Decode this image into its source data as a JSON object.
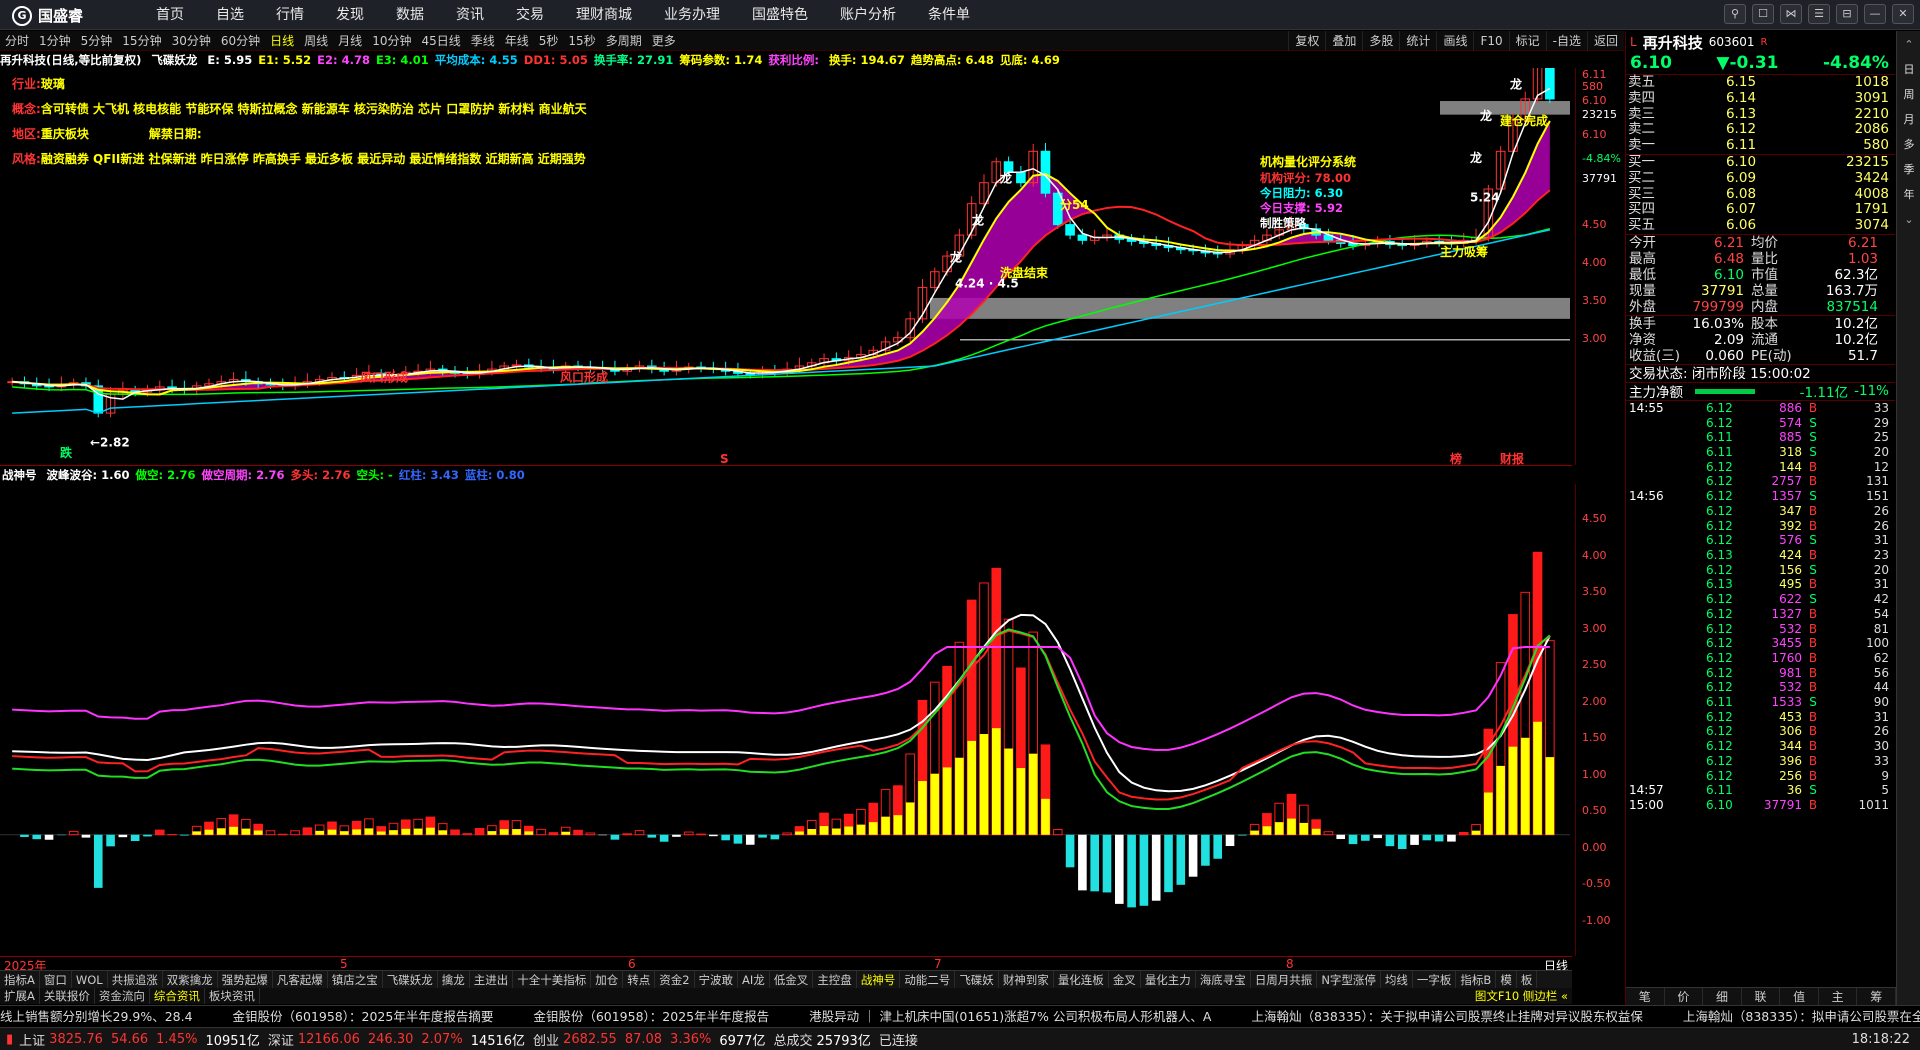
{
  "app": {
    "name": "国盛睿"
  },
  "menu": [
    "首页",
    "自选",
    "行情",
    "发现",
    "数据",
    "资讯",
    "交易",
    "理财商城",
    "业务办理",
    "国盛特色",
    "账户分析",
    "条件单"
  ],
  "window_controls": [
    "⚲",
    "☐",
    "⋈",
    "☰",
    "⊟",
    "—",
    "✕"
  ],
  "periods": [
    "分时",
    "1分钟",
    "5分钟",
    "15分钟",
    "30分钟",
    "60分钟",
    "日线",
    "周线",
    "月线",
    "10分钟",
    "45日线",
    "季线",
    "年线",
    "5秒",
    "15秒",
    "多周期",
    "更多"
  ],
  "active_period": "日线",
  "chart_tools": [
    "复权",
    "叠加",
    "多股",
    "统计",
    "画线",
    "F10",
    "标记",
    "-自选",
    "返回"
  ],
  "main_indicator": {
    "prefix": "再升科技(日线,等比前复权)",
    "name": "飞碟妖龙",
    "items": [
      {
        "t": "E: 5.95",
        "c": "#ffffff"
      },
      {
        "t": "E1: 5.52",
        "c": "#ffff00"
      },
      {
        "t": "E2: 4.78",
        "c": "#ff44ff"
      },
      {
        "t": "E3: 4.01",
        "c": "#00ff00"
      },
      {
        "t": "平均成本: 4.55",
        "c": "#00ccff"
      },
      {
        "t": "DD1: 5.05",
        "c": "#ff3333"
      },
      {
        "t": "换手率: 27.91",
        "c": "#00ff88"
      },
      {
        "t": "筹码参数: 1.74",
        "c": "#ffff00"
      },
      {
        "t": "获利比例: ",
        "c": "#ff44ff"
      },
      {
        "t": "换手: 194.67",
        "c": "#ffff00"
      },
      {
        "t": "趋势高点: 6.48",
        "c": "#ffff00"
      },
      {
        "t": "见底: 4.69",
        "c": "#ffff00"
      }
    ]
  },
  "stock_info": {
    "industry_label": "行业:",
    "industry": "玻璃",
    "concept_label": "概念:",
    "concepts": "含可转债 大飞机 核电核能 节能环保 特斯拉概念 新能源车 核污染防治 芯片 口罩防护 新材料 商业航天",
    "region_label": "地区:",
    "region": "重庆板块",
    "unlock_label": "解禁日期:",
    "style_label": "风格:",
    "styles": "融资融券 QFII新进 社保新进 昨日涨停 昨高换手 最近多板 最近异动 最近情绪指数 近期新高 近期强势"
  },
  "quant_box": {
    "title": "机构量化评分系统",
    "items": [
      {
        "t": "机构评分: 78.00",
        "c": "#ff3333"
      },
      {
        "t": "今日阻力: 6.30",
        "c": "#00ffff"
      },
      {
        "t": "今日支撑: 5.92",
        "c": "#ff44ff"
      },
      {
        "t": "制胜策略",
        "c": "#ffffff"
      }
    ]
  },
  "annotations": {
    "low_price": "←2.82",
    "up_low": "跌",
    "fengkou1": "风口形成",
    "fengkou2": "风口形成",
    "dragon": "龙",
    "fen": "分54",
    "xuanpan": "洗盘结束",
    "price_424": "4.24 · 4.5",
    "price_524": "5.24",
    "suo": "建仓完成",
    "zhuli": "主力吸筹",
    "high_label": "6.48",
    "bottom_mark1": "榜",
    "bottom_mark2": "财报",
    "s_mark": "S"
  },
  "main_axis": [
    "6.11",
    "580",
    "6.10",
    "23215",
    "6.10",
    "-4.84%",
    "37791",
    "4.50",
    "4.00",
    "3.50",
    "3.00"
  ],
  "sub_indicator": {
    "name": "战神号",
    "items": [
      {
        "t": "波峰波谷: 1.60",
        "c": "#ffffff"
      },
      {
        "t": "做空: 2.76",
        "c": "#00ff00"
      },
      {
        "t": "做空周期: 2.76",
        "c": "#ff44ff"
      },
      {
        "t": "多头: 2.76",
        "c": "#ff3333"
      },
      {
        "t": "空头: -",
        "c": "#00ff00"
      },
      {
        "t": "红柱: 3.43",
        "c": "#3366ff"
      },
      {
        "t": "蓝柱: 0.80",
        "c": "#3366ff"
      }
    ]
  },
  "sub_axis": [
    "4.50",
    "4.00",
    "3.50",
    "3.00",
    "2.50",
    "2.00",
    "1.50",
    "1.00",
    "0.50",
    "0.00",
    "-0.50",
    "-1.00"
  ],
  "xaxis": {
    "labels": [
      "2025年",
      "5",
      "6",
      "7",
      "8"
    ],
    "period": "日线"
  },
  "tabs1": [
    "指标A",
    "窗口",
    "WOL",
    "共振追涨",
    "双紫擒龙",
    "强势起爆",
    "凡客起爆",
    "镇店之宝",
    "飞碟妖龙",
    "擒龙",
    "主进出",
    "十全十美指标",
    "加仓",
    "转点",
    "资金2",
    "宁波敢",
    "AI龙",
    "低金叉",
    "主控盘",
    "战神号",
    "动能二号",
    "飞碟妖",
    "财神到家",
    "量化连板",
    "金叉",
    "量化主力",
    "海底寻宝",
    "日周月共振",
    "N字型涨停",
    "均线",
    "一字板",
    "指标B",
    "模",
    "板"
  ],
  "tabs1_active": "战神号",
  "tabs2": [
    "扩展A",
    "关联报价",
    "资金流向",
    "综合资讯",
    "板块资讯"
  ],
  "tabs2_active": "综合资讯",
  "tabs2_right": "图文F10 侧边栏 «",
  "right_panel": {
    "L": "L",
    "name": "再升科技",
    "code": "603601",
    "R": "R",
    "price": "6.10",
    "change": "▼-0.31",
    "pct": "-4.84%",
    "asks": [
      {
        "l": "卖五",
        "p": "6.15",
        "v": "1018"
      },
      {
        "l": "卖四",
        "p": "6.14",
        "v": "3091"
      },
      {
        "l": "卖三",
        "p": "6.13",
        "v": "2210"
      },
      {
        "l": "卖二",
        "p": "6.12",
        "v": "2086"
      },
      {
        "l": "卖一",
        "p": "6.11",
        "v": "580"
      }
    ],
    "bids": [
      {
        "l": "买一",
        "p": "6.10",
        "v": "23215"
      },
      {
        "l": "买二",
        "p": "6.09",
        "v": "3424"
      },
      {
        "l": "买三",
        "p": "6.08",
        "v": "4008"
      },
      {
        "l": "买四",
        "p": "6.07",
        "v": "1791"
      },
      {
        "l": "买五",
        "p": "6.06",
        "v": "3074"
      }
    ],
    "stats": [
      [
        "今开",
        "6.21",
        "vr",
        "均价",
        "6.21",
        "vr"
      ],
      [
        "最高",
        "6.48",
        "vr",
        "量比",
        "1.03",
        "vr"
      ],
      [
        "最低",
        "6.10",
        "vg",
        "市值",
        "62.3亿",
        "vw"
      ],
      [
        "现量",
        "37791",
        "vy",
        "总量",
        "163.7万",
        "vw"
      ],
      [
        "外盘",
        "799799",
        "vr",
        "内盘",
        "837514",
        "vg"
      ]
    ],
    "stats2": [
      [
        "换手",
        "16.03%",
        "vw",
        "股本",
        "10.2亿",
        "vw"
      ],
      [
        "净资",
        "2.09",
        "vw",
        "流通",
        "10.2亿",
        "vw"
      ],
      [
        "收益(三)",
        "0.060",
        "vw",
        "PE(动)",
        "51.7",
        "vw"
      ]
    ],
    "trade_state": "交易状态: 闭市阶段 15:00:02",
    "mainflow_label": "主力净额",
    "mainflow_val": "-1.11亿",
    "mainflow_pct": "-11%",
    "ticks": [
      {
        "t": "14:55",
        "p": "6.12",
        "v": "886",
        "vc": "#ff44ff",
        "s": "B",
        "sc": "#ff3333",
        "n": "33"
      },
      {
        "t": "",
        "p": "6.12",
        "v": "574",
        "vc": "#ff44ff",
        "s": "S",
        "sc": "#00ff66",
        "n": "29"
      },
      {
        "t": "",
        "p": "6.11",
        "v": "885",
        "vc": "#ff44ff",
        "s": "S",
        "sc": "#00ff66",
        "n": "25"
      },
      {
        "t": "",
        "p": "6.11",
        "v": "318",
        "vc": "#ffff66",
        "s": "S",
        "sc": "#00ff66",
        "n": "20"
      },
      {
        "t": "",
        "p": "6.12",
        "v": "144",
        "vc": "#ffff66",
        "s": "B",
        "sc": "#ff3333",
        "n": "12"
      },
      {
        "t": "",
        "p": "6.12",
        "v": "2757",
        "vc": "#ff44ff",
        "s": "B",
        "sc": "#ff3333",
        "n": "131"
      },
      {
        "t": "14:56",
        "p": "6.12",
        "v": "1357",
        "vc": "#ff44ff",
        "s": "S",
        "sc": "#00ff66",
        "n": "151"
      },
      {
        "t": "",
        "p": "6.12",
        "v": "347",
        "vc": "#ffff66",
        "s": "B",
        "sc": "#ff3333",
        "n": "26"
      },
      {
        "t": "",
        "p": "6.12",
        "v": "392",
        "vc": "#ffff66",
        "s": "B",
        "sc": "#ff3333",
        "n": "26"
      },
      {
        "t": "",
        "p": "6.12",
        "v": "576",
        "vc": "#ff44ff",
        "s": "S",
        "sc": "#00ff66",
        "n": "31"
      },
      {
        "t": "",
        "p": "6.13",
        "v": "424",
        "vc": "#ffff66",
        "s": "B",
        "sc": "#ff3333",
        "n": "23"
      },
      {
        "t": "",
        "p": "6.12",
        "v": "156",
        "vc": "#ffff66",
        "s": "S",
        "sc": "#00ff66",
        "n": "20"
      },
      {
        "t": "",
        "p": "6.13",
        "v": "495",
        "vc": "#ffff66",
        "s": "B",
        "sc": "#ff3333",
        "n": "31"
      },
      {
        "t": "",
        "p": "6.12",
        "v": "622",
        "vc": "#ff44ff",
        "s": "S",
        "sc": "#00ff66",
        "n": "42"
      },
      {
        "t": "",
        "p": "6.12",
        "v": "1327",
        "vc": "#ff44ff",
        "s": "B",
        "sc": "#ff3333",
        "n": "54"
      },
      {
        "t": "",
        "p": "6.12",
        "v": "532",
        "vc": "#ff44ff",
        "s": "B",
        "sc": "#ff3333",
        "n": "81"
      },
      {
        "t": "",
        "p": "6.12",
        "v": "3455",
        "vc": "#ff44ff",
        "s": "B",
        "sc": "#ff3333",
        "n": "100"
      },
      {
        "t": "",
        "p": "6.12",
        "v": "1760",
        "vc": "#ff44ff",
        "s": "B",
        "sc": "#ff3333",
        "n": "62"
      },
      {
        "t": "",
        "p": "6.12",
        "v": "981",
        "vc": "#ff44ff",
        "s": "B",
        "sc": "#ff3333",
        "n": "56"
      },
      {
        "t": "",
        "p": "6.12",
        "v": "532",
        "vc": "#ff44ff",
        "s": "B",
        "sc": "#ff3333",
        "n": "44"
      },
      {
        "t": "",
        "p": "6.11",
        "v": "1533",
        "vc": "#ff44ff",
        "s": "S",
        "sc": "#00ff66",
        "n": "90"
      },
      {
        "t": "",
        "p": "6.12",
        "v": "453",
        "vc": "#ffff66",
        "s": "B",
        "sc": "#ff3333",
        "n": "31"
      },
      {
        "t": "",
        "p": "6.12",
        "v": "306",
        "vc": "#ffff66",
        "s": "B",
        "sc": "#ff3333",
        "n": "26"
      },
      {
        "t": "",
        "p": "6.12",
        "v": "344",
        "vc": "#ffff66",
        "s": "B",
        "sc": "#ff3333",
        "n": "30"
      },
      {
        "t": "",
        "p": "6.12",
        "v": "396",
        "vc": "#ffff66",
        "s": "B",
        "sc": "#ff3333",
        "n": "33"
      },
      {
        "t": "",
        "p": "6.12",
        "v": "256",
        "vc": "#ffff66",
        "s": "B",
        "sc": "#ff3333",
        "n": "9"
      },
      {
        "t": "14:57",
        "p": "6.11",
        "v": "36",
        "vc": "#ffff66",
        "s": "S",
        "sc": "#00ff66",
        "n": "5"
      },
      {
        "t": "15:00",
        "p": "6.10",
        "v": "37791",
        "vc": "#ff44ff",
        "s": "B",
        "sc": "#ff3333",
        "n": "1011"
      }
    ],
    "tabs": [
      "笔",
      "价",
      "细",
      "联",
      "值",
      "主",
      "筹"
    ]
  },
  "side_icons": [
    "⌃",
    "日",
    "周",
    "月",
    "多",
    "季",
    "年",
    "⌄"
  ],
  "ticker": [
    "线上销售额分别增长29.9%、28.4",
    "金钼股份（601958）：2025年半年度报告摘要",
    "金钼股份（601958）：2025年半年度报告",
    "港股异动 ｜ 津上机床中国(01651)涨超7% 公司积极布局人形机器人、A",
    "上海翰灿（838335）：关于拟申请公司股票终止挂牌对异议股东权益保",
    "上海翰灿（838335）：拟申请公司股票在全国中小企业股份转"
  ],
  "status": [
    {
      "n": "上证",
      "v": "3825.76",
      "c": "54.66",
      "p": "1.45%",
      "a": "10951亿"
    },
    {
      "n": "深证",
      "v": "12166.06",
      "c": "246.30",
      "p": "2.07%",
      "a": "14516亿"
    },
    {
      "n": "创业",
      "v": "2682.55",
      "c": "87.08",
      "p": "3.36%",
      "a": "6977亿"
    }
  ],
  "status_total_label": "总成交",
  "status_total": "25793亿",
  "status_conn": "已连接",
  "status_time": "18:18:22",
  "colors": {
    "up": "#ff3333",
    "down": "#00ffff",
    "ma5": "#ffffff",
    "ma10": "#ffff00",
    "ma20": "#ff44ff",
    "ma60": "#00ff00",
    "cost": "#00ccff"
  },
  "chart_data": {
    "type": "candlestick",
    "price_ylim": [
      2.7,
      6.3
    ],
    "closes": [
      3.4,
      3.38,
      3.36,
      3.35,
      3.37,
      3.39,
      3.36,
      3.1,
      3.28,
      3.32,
      3.3,
      3.32,
      3.35,
      3.33,
      3.32,
      3.36,
      3.38,
      3.4,
      3.42,
      3.4,
      3.38,
      3.37,
      3.36,
      3.38,
      3.4,
      3.42,
      3.44,
      3.43,
      3.46,
      3.48,
      3.45,
      3.47,
      3.49,
      3.5,
      3.52,
      3.5,
      3.48,
      3.47,
      3.5,
      3.52,
      3.55,
      3.56,
      3.54,
      3.53,
      3.52,
      3.55,
      3.54,
      3.53,
      3.52,
      3.5,
      3.53,
      3.55,
      3.52,
      3.5,
      3.52,
      3.54,
      3.53,
      3.52,
      3.5,
      3.48,
      3.47,
      3.5,
      3.49,
      3.52,
      3.55,
      3.58,
      3.62,
      3.6,
      3.63,
      3.66,
      3.7,
      3.78,
      3.82,
      4.0,
      4.3,
      4.45,
      4.6,
      4.8,
      5.1,
      5.3,
      5.5,
      5.4,
      5.3,
      5.6,
      5.2,
      4.9,
      4.8,
      4.75,
      4.78,
      4.8,
      4.76,
      4.74,
      4.72,
      4.7,
      4.68,
      4.66,
      4.65,
      4.63,
      4.62,
      4.66,
      4.7,
      4.75,
      4.8,
      4.85,
      4.9,
      4.86,
      4.8,
      4.75,
      4.72,
      4.7,
      4.72,
      4.74,
      4.71,
      4.7,
      4.72,
      4.74,
      4.73,
      4.72,
      4.75,
      4.78,
      5.24,
      5.6,
      5.9,
      6.1,
      6.4,
      6.1
    ],
    "sub_ylim": [
      -1.6,
      4.9
    ],
    "note": "sub chart histogram and oscillator lines"
  }
}
